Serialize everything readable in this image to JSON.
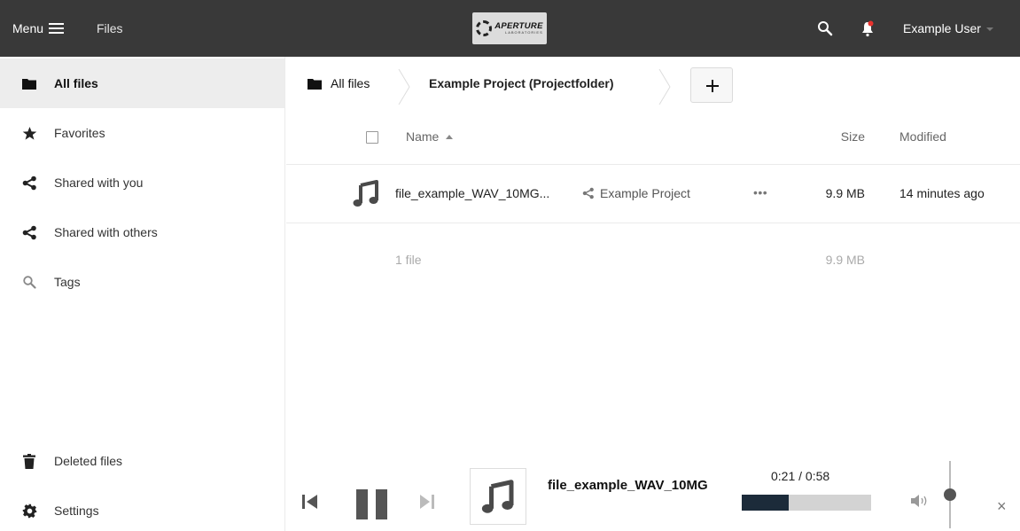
{
  "header": {
    "menu_label": "Menu",
    "app_name": "Files",
    "logo_text_main": "APERTURE",
    "logo_text_sub": "LABORATORIES",
    "user_name": "Example User"
  },
  "sidebar": {
    "items": [
      {
        "label": "All files",
        "icon": "folder-icon",
        "active": true
      },
      {
        "label": "Favorites",
        "icon": "star-icon",
        "active": false
      },
      {
        "label": "Shared with you",
        "icon": "share-icon",
        "active": false
      },
      {
        "label": "Shared with others",
        "icon": "share-icon",
        "active": false
      },
      {
        "label": "Tags",
        "icon": "search-icon",
        "active": false
      }
    ],
    "bottom_items": [
      {
        "label": "Deleted files",
        "icon": "trash-icon"
      },
      {
        "label": "Settings",
        "icon": "gear-icon"
      }
    ]
  },
  "breadcrumb": {
    "root_label": "All files",
    "current_label": "Example Project (Projectfolder)"
  },
  "table": {
    "columns": {
      "name": "Name",
      "size": "Size",
      "modified": "Modified"
    },
    "rows": [
      {
        "name": "file_example_WAV_10MG...",
        "icon": "music-note-icon",
        "shared_with": "Example Project",
        "actions": "•••",
        "size": "9.9 MB",
        "modified": "14 minutes ago"
      }
    ],
    "summary": {
      "count": "1 file",
      "size": "9.9 MB"
    }
  },
  "player": {
    "track_title": "file_example_WAV_10MG",
    "time": "0:21 / 0:58",
    "progress_fraction": 0.362,
    "volume_fraction": 0.5,
    "close_label": "×"
  },
  "colors": {
    "header_bg": "#393939",
    "active_nav_bg": "#ededed",
    "progress_fill": "#1c2b3a",
    "progress_track": "#d3d3d3",
    "notification_dot": "#e9322d"
  }
}
